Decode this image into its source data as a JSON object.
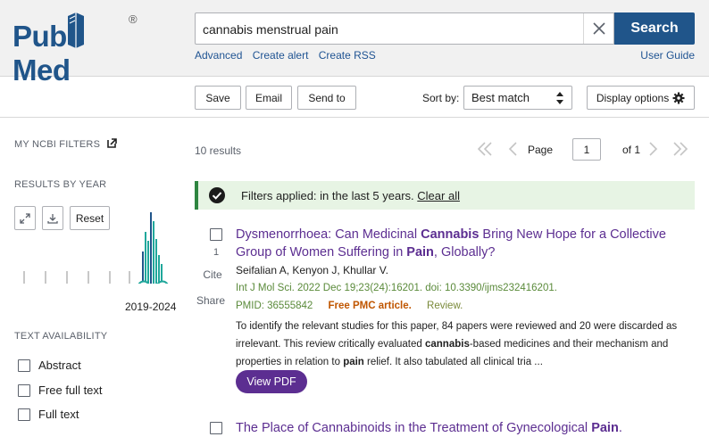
{
  "header": {
    "logo_pub": "Pub",
    "logo_med": "Med",
    "logo_reg": "®",
    "search_value": "cannabis menstrual pain",
    "search_button": "Search",
    "links": [
      "Advanced",
      "Create alert",
      "Create RSS"
    ],
    "user_guide": "User Guide"
  },
  "toolbar": {
    "save": "Save",
    "email": "Email",
    "send_to": "Send to",
    "sort_label": "Sort by:",
    "sort_value": "Best match",
    "display_options": "Display options"
  },
  "sidebar": {
    "my_ncbi_filters": "MY NCBI FILTERS",
    "results_by_year": "RESULTS BY YEAR",
    "reset": "Reset",
    "year_range": "2019-2024",
    "text_availability": "TEXT AVAILABILITY",
    "filters": [
      "Abstract",
      "Free full text",
      "Full text"
    ]
  },
  "results": {
    "count": "10 results",
    "page_label": "Page",
    "page_value": "1",
    "page_of": "of 1",
    "filter_applied": "Filters applied: in the last 5 years.",
    "clear_all": "Clear all",
    "items": [
      {
        "number": "1",
        "cite": "Cite",
        "share": "Share",
        "title_parts": [
          {
            "text": "Dysmenorrhoea: Can Medicinal ",
            "bold": false
          },
          {
            "text": "Cannabis",
            "bold": true
          },
          {
            "text": " Bring New Hope for a Collective Group of Women Suffering in ",
            "bold": false
          },
          {
            "text": "Pain",
            "bold": true
          },
          {
            "text": ", Globally?",
            "bold": false
          }
        ],
        "authors": "Seifalian A, Kenyon J, Khullar V.",
        "journal": "Int J Mol Sci. 2022 Dec 19;23(24):16201. doi: 10.3390/ijms232416201.",
        "pmid": "PMID: 36555842",
        "free_pmc": "Free PMC article.",
        "review": "Review.",
        "snippet_parts": [
          {
            "text": "To identify the relevant studies for this paper, 84 papers were reviewed and 20 were discarded as irrelevant. This review critically evaluated ",
            "bold": false
          },
          {
            "text": "cannabis",
            "bold": true
          },
          {
            "text": "-based medicines and their mechanism and properties in relation to ",
            "bold": false
          },
          {
            "text": "pain",
            "bold": true
          },
          {
            "text": " relief. It also tabulated all clinical tria ...",
            "bold": false
          }
        ],
        "view_pdf": "View PDF"
      },
      {
        "title_parts": [
          {
            "text": "The Place of Cannabinoids in the Treatment of Gynecological ",
            "bold": false
          },
          {
            "text": "Pain",
            "bold": true
          },
          {
            "text": ".",
            "bold": false
          }
        ]
      }
    ]
  },
  "colors": {
    "brand_blue": "#20558a",
    "link_blue": "#205493",
    "title_purple": "#5c2e91",
    "journal_green": "#5a8a3a",
    "free_pmc_orange": "#c05600",
    "review_olive": "#7a8a3a",
    "chart_teal": "#20a79b",
    "chart_blue": "#20558a"
  }
}
